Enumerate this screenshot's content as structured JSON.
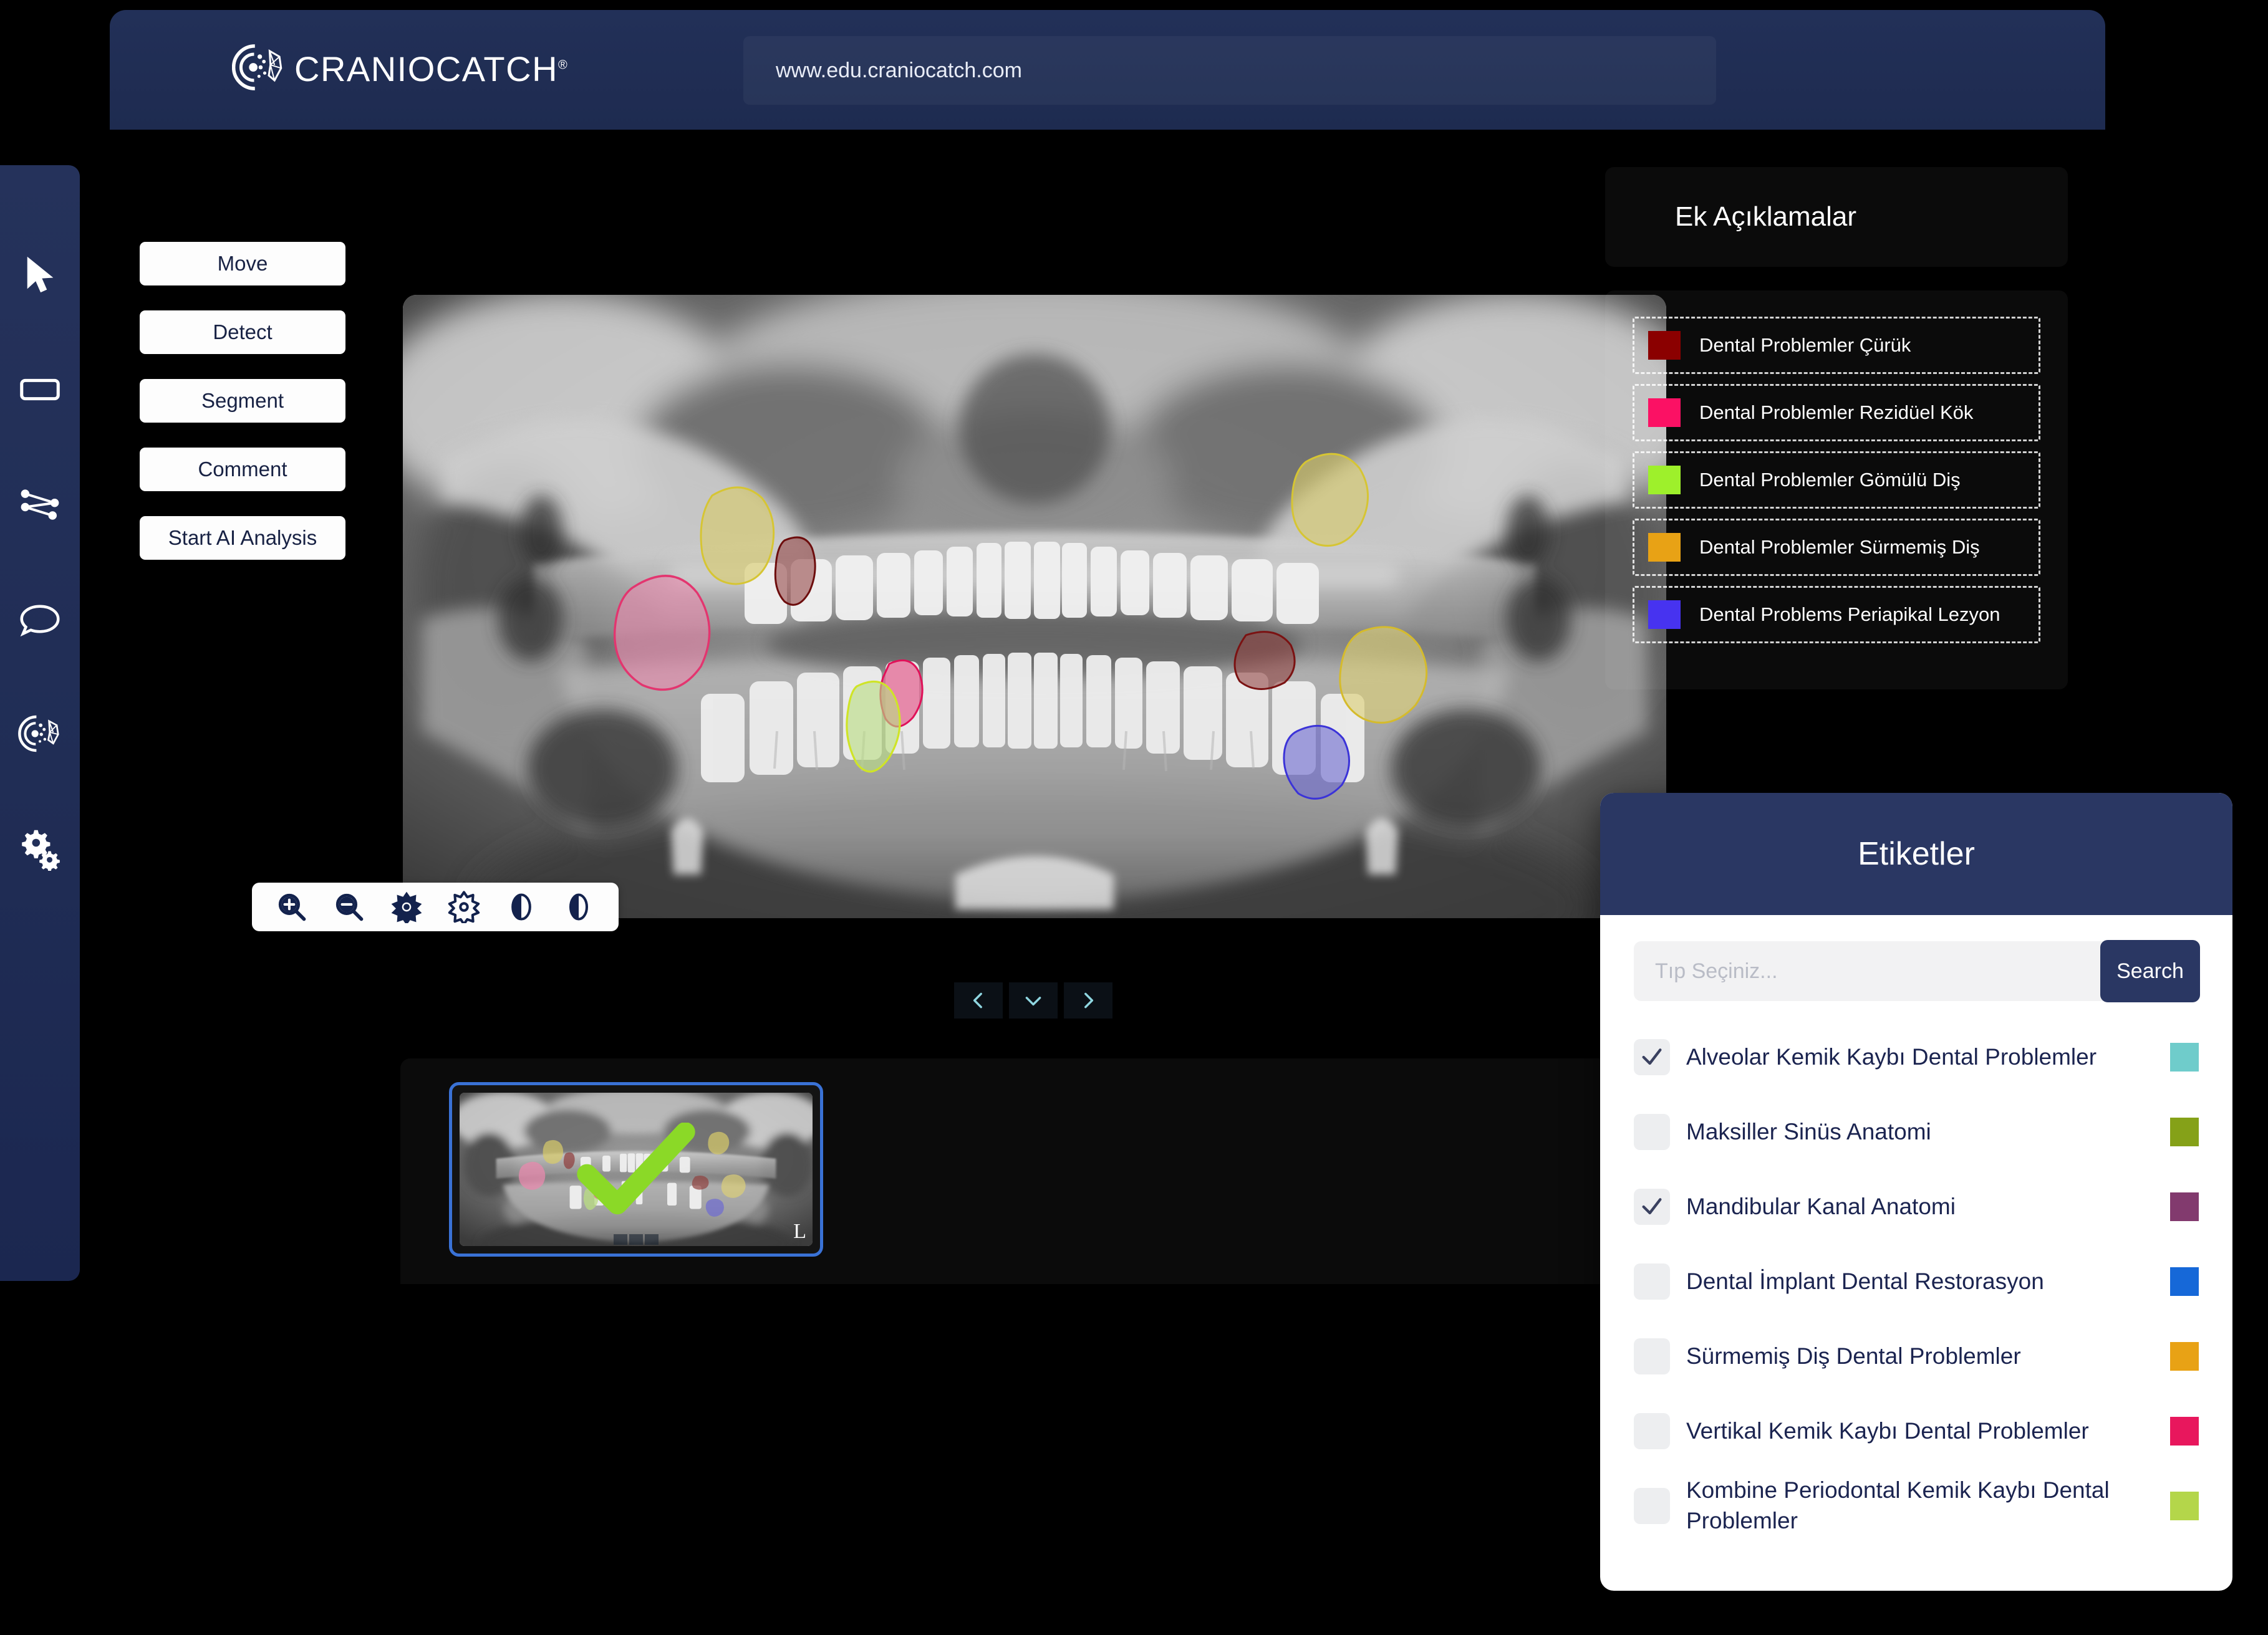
{
  "brand": {
    "name": "CRANIOCATCH",
    "registered": "®",
    "logo_icon": "craniocatch-logo-icon"
  },
  "urlbar": {
    "value": "www.edu.craniocatch.com"
  },
  "tool_rail": {
    "items": [
      {
        "icon": "cursor-arrow-icon",
        "name": "select-tool"
      },
      {
        "icon": "rectangle-icon",
        "name": "rectangle-tool"
      },
      {
        "icon": "polyline-icon",
        "name": "polyline-tool"
      },
      {
        "icon": "comment-bubble-icon",
        "name": "comment-tool"
      },
      {
        "icon": "craniocatch-ai-icon",
        "name": "ai-tool"
      },
      {
        "icon": "gears-icon",
        "name": "settings-tool"
      }
    ]
  },
  "actions": [
    {
      "label": "Move"
    },
    {
      "label": "Detect"
    },
    {
      "label": "Segment"
    },
    {
      "label": "Comment"
    },
    {
      "label": "Start AI Analysis"
    }
  ],
  "viewer": {
    "orientation_marker": "L",
    "tools": [
      {
        "icon": "zoom-in-icon",
        "name": "zoom-in-button"
      },
      {
        "icon": "zoom-out-icon",
        "name": "zoom-out-button"
      },
      {
        "icon": "brightness-up-icon",
        "name": "brightness-up-button"
      },
      {
        "icon": "brightness-down-icon",
        "name": "brightness-down-button"
      },
      {
        "icon": "contrast-icon",
        "name": "contrast-up-button"
      },
      {
        "icon": "contrast-half-icon",
        "name": "contrast-down-button"
      }
    ],
    "nav": [
      {
        "icon": "chevron-left-icon",
        "name": "previous-image-button"
      },
      {
        "icon": "chevron-down-icon",
        "name": "expand-list-button"
      },
      {
        "icon": "chevron-right-icon",
        "name": "next-image-button"
      }
    ],
    "annotations": [
      {
        "name": "surmemis-dis-upper-left",
        "color": "#c9b74a",
        "cx": 0.255,
        "cy": 0.275
      },
      {
        "name": "surmemis-dis-upper-right",
        "color": "#c9b74a",
        "cx": 0.735,
        "cy": 0.275
      },
      {
        "name": "surmemis-dis-lower-right",
        "color": "#c9a93f",
        "cx": 0.785,
        "cy": 0.575
      },
      {
        "name": "curuk-left",
        "color": "#8c2f2f",
        "cx": 0.313,
        "cy": 0.43
      },
      {
        "name": "curuk-right",
        "color": "#8c2f2f",
        "cx": 0.69,
        "cy": 0.59
      },
      {
        "name": "rezidual-kok-large",
        "color": "#e0457f",
        "cx": 0.211,
        "cy": 0.53
      },
      {
        "name": "rezidual-kok-small",
        "color": "#e0457f",
        "cx": 0.4,
        "cy": 0.625
      },
      {
        "name": "gomulu-dis",
        "color": "#a8d05a",
        "cx": 0.382,
        "cy": 0.69
      },
      {
        "name": "periapikal-lezyon",
        "color": "#5a56c8",
        "cx": 0.728,
        "cy": 0.74
      }
    ]
  },
  "thumbnail": {
    "check_icon": "green-check-icon",
    "orientation_marker": "L",
    "selected": true
  },
  "annotations_panel": {
    "title": "Ek Açıklamalar",
    "legend": [
      {
        "label": "Dental Problemler Çürük",
        "color": "#8B0000"
      },
      {
        "label": "Dental Problemler Rezidüel Kök",
        "color": "#FB1164"
      },
      {
        "label": "Dental Problemler Gömülü Diş",
        "color": "#9EF02B"
      },
      {
        "label": "Dental Problemler Sürmemiş Diş",
        "color": "#E8A215"
      },
      {
        "label": "Dental Problems Periapikal Lezyon",
        "color": "#4733F0"
      }
    ]
  },
  "tags_panel": {
    "title": "Etiketler",
    "search": {
      "placeholder": "Tıp Seçiniz...",
      "value": "",
      "button_label": "Search"
    },
    "items": [
      {
        "label": "Alveolar Kemik Kaybı Dental Problemler",
        "color": "#6FCCCB",
        "checked": true
      },
      {
        "label": "Maksiller Sinüs Anatomi",
        "color": "#85A118",
        "checked": false
      },
      {
        "label": "Mandibular Kanal Anatomi",
        "color": "#823A6E",
        "checked": true
      },
      {
        "label": "Dental İmplant Dental Restorasyon",
        "color": "#1668D8",
        "checked": false
      },
      {
        "label": "Sürmemiş Diş Dental Problemler",
        "color": "#E8A215",
        "checked": false
      },
      {
        "label": "Vertikal Kemik Kaybı Dental Problemler",
        "color": "#E8175D",
        "checked": false
      },
      {
        "label": "Kombine Periodontal Kemik Kaybı Dental Problemler",
        "color": "#B4D64A",
        "checked": false
      }
    ]
  },
  "theme": {
    "window_bg": "#16224a",
    "topbar_bg": "#223058",
    "rail_bg": "#22305a",
    "accent": "#2a3763",
    "text_light": "#ffffff",
    "text_dark": "#1b2450"
  }
}
